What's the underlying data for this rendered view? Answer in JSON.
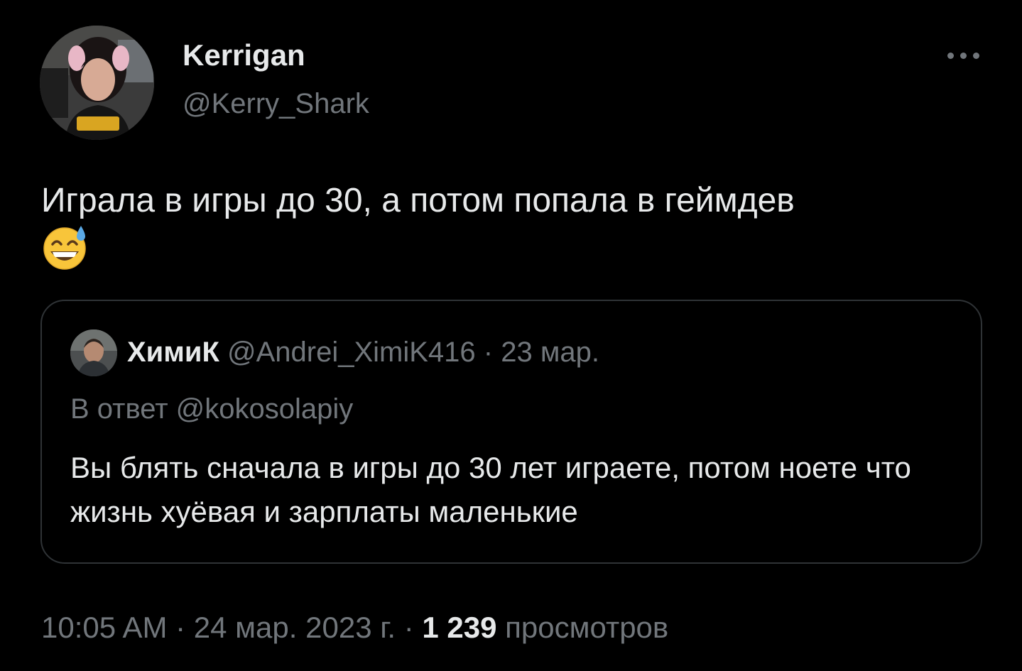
{
  "tweet": {
    "author": {
      "display_name": "Kerrigan",
      "handle": "@Kerry_Shark"
    },
    "text": "Играла в игры до 30, а потом попала в геймдев",
    "emoji": "grinning-face-with-sweat-emoji",
    "meta": {
      "time": "10:05 AM",
      "separator_1": " · ",
      "date": "24 мар. 2023 г.",
      "separator_2": " · ",
      "views_count": "1 239",
      "views_label": " просмотров"
    }
  },
  "quoted_tweet": {
    "author": {
      "display_name": "ХимиК",
      "handle": "@Andrei_XimiK416",
      "separator": " · ",
      "date": "23 мар."
    },
    "reply_to": "В ответ @kokosolapiy",
    "text": "Вы блять сначала в игры до 30 лет играете, потом ноете что жизнь хуёвая и зарплаты маленькие"
  },
  "colors": {
    "background": "#000000",
    "primary_text": "#e7e9ea",
    "secondary_text": "#71767b",
    "border": "#2f3336"
  },
  "icons": {
    "more": "more-horizontal-icon"
  }
}
